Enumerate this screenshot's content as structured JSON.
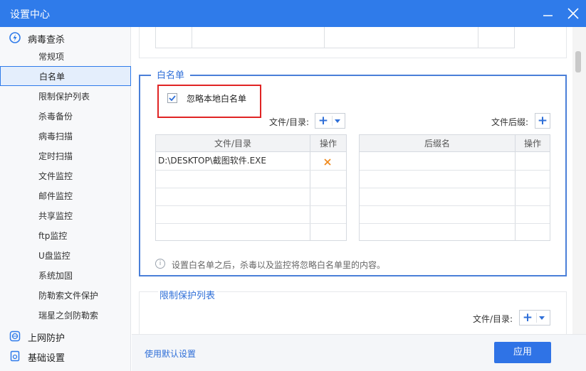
{
  "window": {
    "title": "设置中心"
  },
  "sidebar": {
    "groups": [
      {
        "label": "病毒查杀",
        "icon": "virus-scan-icon"
      },
      {
        "label": "上网防护",
        "icon": "web-protect-icon"
      },
      {
        "label": "基础设置",
        "icon": "basic-settings-icon"
      }
    ],
    "items": [
      {
        "label": "常规项"
      },
      {
        "label": "白名单",
        "active": true
      },
      {
        "label": "限制保护列表"
      },
      {
        "label": "杀毒备份"
      },
      {
        "label": "病毒扫描"
      },
      {
        "label": "定时扫描"
      },
      {
        "label": "文件监控"
      },
      {
        "label": "邮件监控"
      },
      {
        "label": "共享监控"
      },
      {
        "label": "ftp监控"
      },
      {
        "label": "U盘监控"
      },
      {
        "label": "系统加固"
      },
      {
        "label": "防勒索文件保护"
      },
      {
        "label": "瑞星之剑防勒索"
      }
    ]
  },
  "whitelist": {
    "title": "白名单",
    "ignore_local_label": "忽略本地白名单",
    "ignore_local_checked": true,
    "files_label": "文件/目录:",
    "suffix_label": "文件后缀:",
    "files_table": {
      "headers": [
        "文件/目录",
        "操作"
      ],
      "rows": [
        {
          "path": "D:\\DESKTOP\\截图软件.EXE"
        }
      ]
    },
    "suffix_table": {
      "headers": [
        "后缀名",
        "操作"
      ]
    },
    "info_text": "设置白名单之后，杀毒以及监控将忽略白名单里的内容。"
  },
  "restrict": {
    "title": "限制保护列表",
    "files_label": "文件/目录:"
  },
  "footer": {
    "default_label": "使用默认设置",
    "apply_label": "应用"
  },
  "colors": {
    "accent": "#2f7bea",
    "highlight_box": "#e02424",
    "delete_x": "#f08a1c"
  }
}
